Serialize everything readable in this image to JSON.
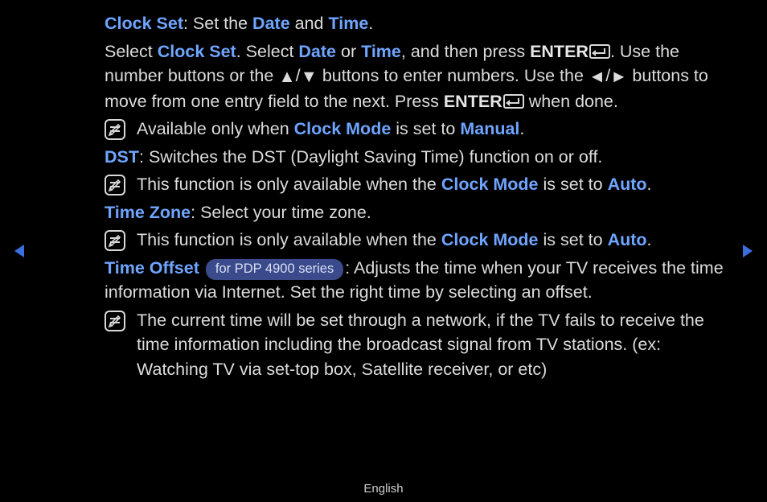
{
  "line1": {
    "clock_set": "Clock Set",
    "post1": ": Set the ",
    "date": "Date",
    "and": " and ",
    "time": "Time",
    "period": "."
  },
  "para1": {
    "t1": "Select ",
    "clock_set": "Clock Set",
    "t2": ". Select ",
    "date": "Date",
    "t3": " or ",
    "time": "Time",
    "t4": ", and then press ",
    "enter": "ENTER",
    "t5": ". Use the number buttons or the ",
    "t6": " buttons to enter numbers. Use the ",
    "t7": " buttons to move from one entry field to the next. Press ",
    "enter2": "ENTER",
    "t8": " when done."
  },
  "note1": {
    "t1": "Available only when ",
    "clock_mode": "Clock Mode",
    "t2": " is set to ",
    "manual": "Manual",
    "period": "."
  },
  "dst": {
    "label": "DST",
    "text": ": Switches the DST (Daylight Saving Time) function on or off."
  },
  "note2": {
    "t1": "This function is only available when the ",
    "clock_mode": "Clock Mode",
    "t2": " is set to ",
    "auto": "Auto",
    "period": "."
  },
  "timezone": {
    "label": "Time Zone",
    "text": ": Select your time zone."
  },
  "note3": {
    "t1": "This function is only available when the ",
    "clock_mode": "Clock Mode",
    "t2": " is set to ",
    "auto": "Auto",
    "period": "."
  },
  "timeoffset": {
    "label": "Time Offset",
    "badge": "for PDP 4900 series",
    "text": ": Adjusts the time when your TV receives the time information via Internet. Set the right time by selecting an offset."
  },
  "note4": {
    "text": "The current time will be set through a network, if the TV fails to receive the time information including the broadcast signal from TV stations. (ex: Watching TV via set-top box, Satellite receiver, or etc)"
  },
  "glyphs": {
    "up": "▲",
    "down": "▼",
    "left": "◄",
    "right": "►",
    "slash": "/"
  },
  "footer": "English"
}
